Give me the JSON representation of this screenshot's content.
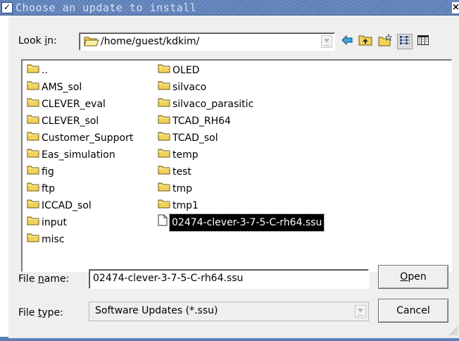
{
  "window": {
    "title": "Choose an update to install"
  },
  "lookin": {
    "label_pre": "Look ",
    "label_u": "i",
    "label_post": "n:",
    "path": "/home/guest/kdkim/"
  },
  "toolbar": {
    "buttons": [
      {
        "name": "back-icon"
      },
      {
        "name": "parent-directory-icon"
      },
      {
        "name": "new-folder-icon"
      },
      {
        "name": "list-view-icon"
      },
      {
        "name": "detail-view-icon"
      }
    ]
  },
  "files": {
    "column1": [
      "..",
      "AMS_sol",
      "CLEVER_eval",
      "CLEVER_sol",
      "Customer_Support",
      "Eas_simulation",
      "fig",
      "ftp",
      "ICCAD_sol",
      "input",
      "misc"
    ],
    "column2": [
      "OLED",
      "silvaco",
      "silvaco_parasitic",
      "TCAD_RH64",
      "TCAD_sol",
      "temp",
      "test",
      "tmp",
      "tmp1"
    ],
    "selected_file": "02474-clever-3-7-5-C-rh64.ssu"
  },
  "filename": {
    "label_pre": "File ",
    "label_u": "n",
    "label_post": "ame:",
    "value": "02474-clever-3-7-5-C-rh64.ssu"
  },
  "filetype": {
    "label_pre": "File ",
    "label_u": "t",
    "label_post": "ype:",
    "value": "Software Updates (*.ssu)"
  },
  "buttons": {
    "open_u": "O",
    "open_rest": "pen",
    "cancel": "Cancel"
  },
  "colors": {
    "titlebar": "#5d7fb8",
    "folder": "#f2d35a",
    "selection": "#000000"
  }
}
